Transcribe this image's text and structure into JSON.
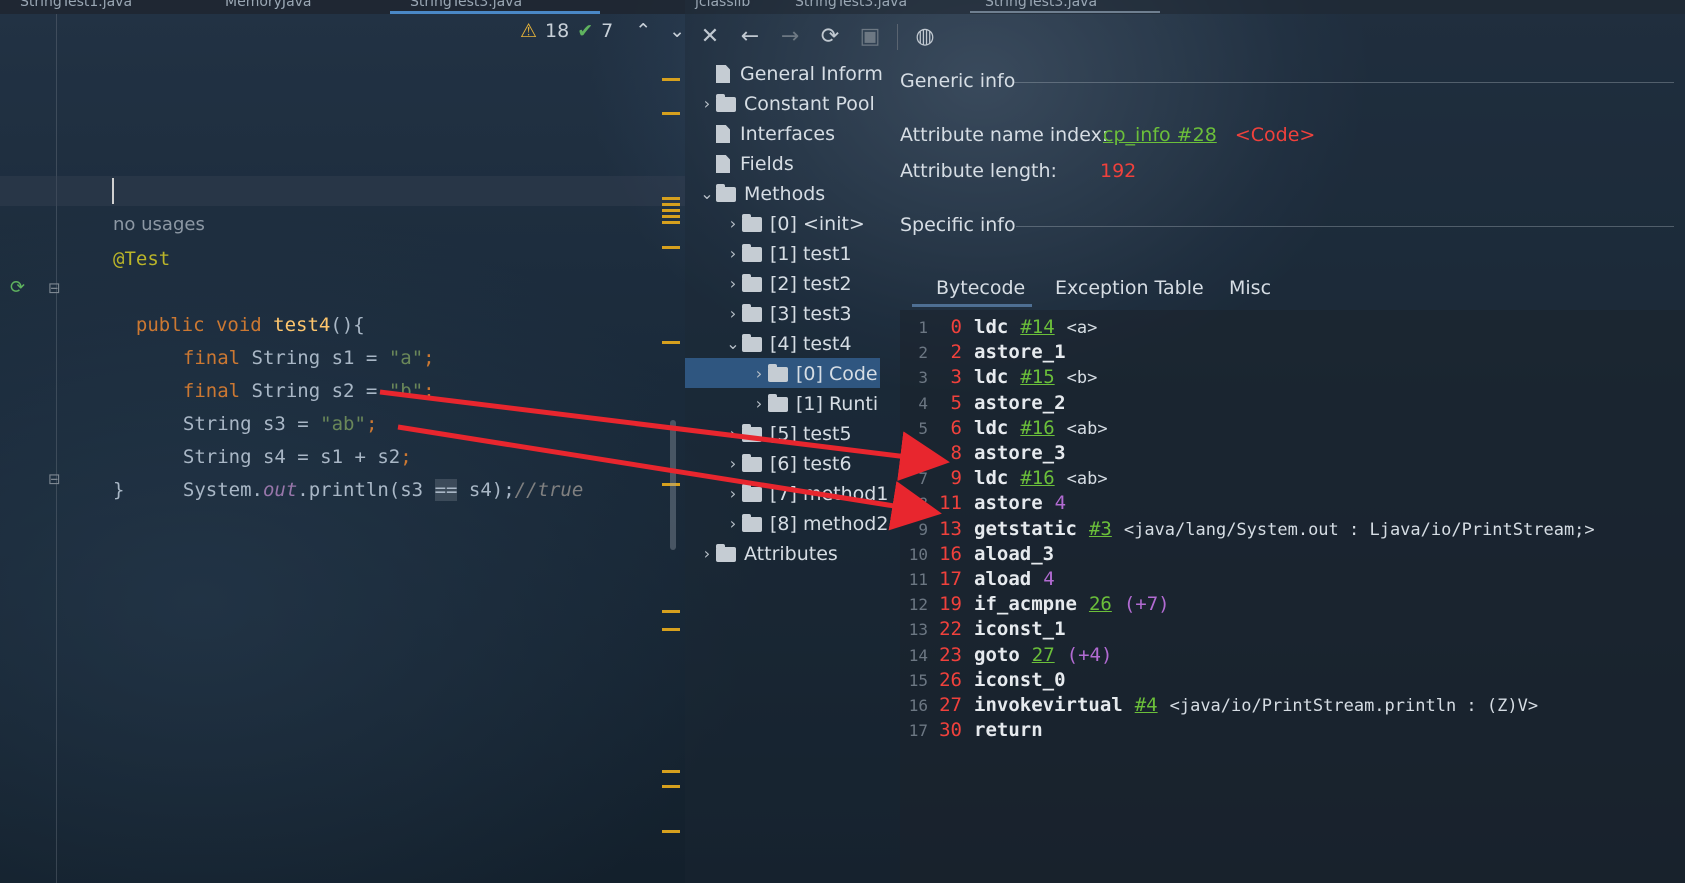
{
  "editor_tabs": [
    "StringTest1.java",
    "MemoryJava",
    "StringTest3.java"
  ],
  "viewer_tabs": [
    "jclasslib",
    "StringTest3.java",
    "StringTest3.java"
  ],
  "status": {
    "warnings": "18",
    "checks": "7"
  },
  "code": {
    "hint": "no usages",
    "annotation": "@Test",
    "lines": [
      {
        "kw": "public void ",
        "fn": "test4",
        "rest": "(){"
      },
      {
        "kw": "final ",
        "type": "String s1 = ",
        "str": "\"a\"",
        "end": ";"
      },
      {
        "kw": "final ",
        "type": "String s2 = ",
        "str": "\"b\"",
        "end": ";"
      },
      {
        "type": "String s3 = ",
        "str": "\"ab\"",
        "end": ";"
      },
      {
        "type": "String s4 = s1 + s2",
        "end": ";"
      },
      {
        "a": "System.",
        "stat": "out",
        "b": ".println(s3 ",
        "op": "==",
        "c": " s4);",
        "cmt": "//true"
      },
      {
        "rest": "}"
      }
    ]
  },
  "toolbar": [
    "close-icon",
    "back-icon",
    "forward-icon",
    "refresh-icon",
    "save-icon",
    "browser-icon"
  ],
  "tree": {
    "items": [
      "General Inform",
      "Constant Pool",
      "Interfaces",
      "Fields",
      "Methods",
      "[0] <init>",
      "[1] test1",
      "[2] test2",
      "[3] test3",
      "[4] test4",
      "[0] Code",
      "[1] Runti",
      "[5] test5",
      "[6] test6",
      "[7] method1",
      "[8] method2",
      "Attributes"
    ]
  },
  "generic": {
    "title": "Generic info",
    "name_index_label": "Attribute name index:",
    "name_index_link": "cp_info #28",
    "name_index_value": "<Code>",
    "length_label": "Attribute length:",
    "length_value": "192",
    "specific": "Specific info"
  },
  "tabs": [
    "Bytecode",
    "Exception Table",
    "Misc"
  ],
  "bytecode": [
    {
      "ln": "1",
      "off": "0",
      "op": "ldc",
      "ref": "#14",
      "cmt": "<a>"
    },
    {
      "ln": "2",
      "off": "2",
      "op": "astore_1"
    },
    {
      "ln": "3",
      "off": "3",
      "op": "ldc",
      "ref": "#15",
      "cmt": "<b>"
    },
    {
      "ln": "4",
      "off": "5",
      "op": "astore_2"
    },
    {
      "ln": "5",
      "off": "6",
      "op": "ldc",
      "ref": "#16",
      "cmt": "<ab>"
    },
    {
      "ln": "6",
      "off": "8",
      "op": "astore_3"
    },
    {
      "ln": "7",
      "off": "9",
      "op": "ldc",
      "ref": "#16",
      "cmt": "<ab>"
    },
    {
      "ln": "8",
      "off": "11",
      "op": "astore",
      "num": "4"
    },
    {
      "ln": "9",
      "off": "13",
      "op": "getstatic",
      "ref": "#3",
      "cmt": "<java/lang/System.out : Ljava/io/PrintStream;>"
    },
    {
      "ln": "10",
      "off": "16",
      "op": "aload_3"
    },
    {
      "ln": "11",
      "off": "17",
      "op": "aload",
      "num": "4"
    },
    {
      "ln": "12",
      "off": "19",
      "op": "if_acmpne",
      "ref": "26",
      "num": "(+7)"
    },
    {
      "ln": "13",
      "off": "22",
      "op": "iconst_1"
    },
    {
      "ln": "14",
      "off": "23",
      "op": "goto",
      "ref": "27",
      "num": "(+4)"
    },
    {
      "ln": "15",
      "off": "26",
      "op": "iconst_0"
    },
    {
      "ln": "16",
      "off": "27",
      "op": "invokevirtual",
      "ref": "#4",
      "cmt": "<java/io/PrintStream.println : (Z)V>"
    },
    {
      "ln": "17",
      "off": "30",
      "op": "return"
    }
  ]
}
